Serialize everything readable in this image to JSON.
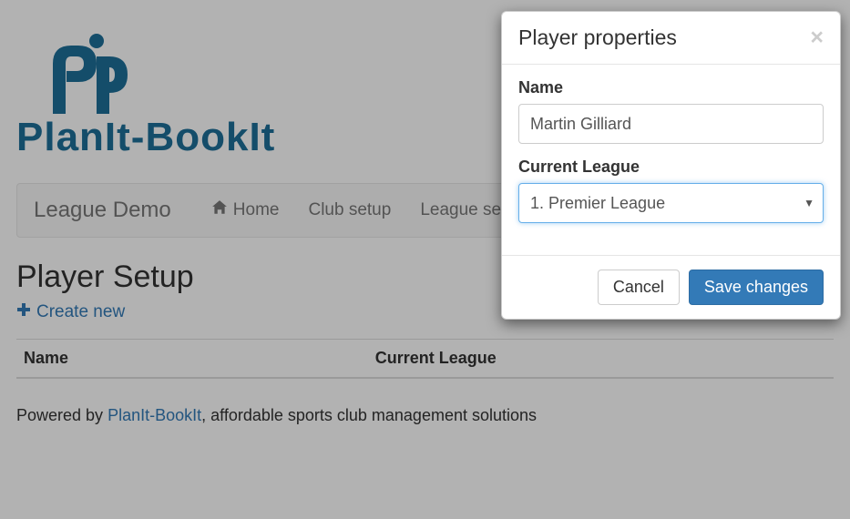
{
  "logo": {
    "text": "PlanIt-BookIt"
  },
  "navbar": {
    "brand": "League Demo",
    "items": [
      {
        "label": "Home",
        "icon": "home"
      },
      {
        "label": "Club setup"
      },
      {
        "label": "League setup"
      }
    ]
  },
  "page": {
    "title": "Player Setup",
    "create_label": "Create new"
  },
  "table": {
    "columns": [
      "Name",
      "Current League"
    ]
  },
  "footer": {
    "prefix": "Powered by ",
    "link": "PlanIt-BookIt",
    "suffix": ", affordable sports club management solutions"
  },
  "modal": {
    "title": "Player properties",
    "name_label": "Name",
    "name_value": "Martin Gilliard",
    "league_label": "Current League",
    "league_value": "1. Premier League",
    "cancel_label": "Cancel",
    "save_label": "Save changes"
  }
}
